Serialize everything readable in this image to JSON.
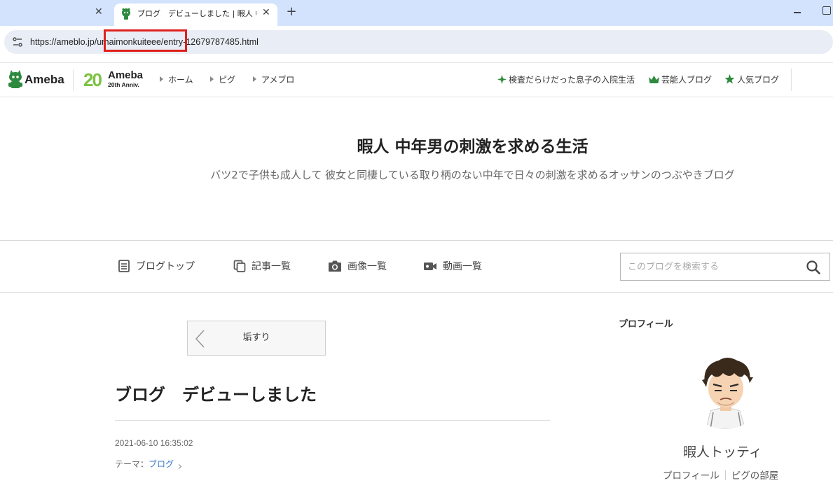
{
  "browser": {
    "active_tab_title": "ブログ　デビューしました | 暇人 中年男の刺激を求める生活",
    "inactive_tab_close": "✕",
    "active_tab_close": "✕",
    "new_tab": "+",
    "url_domain": "https://ameblo.jp/",
    "url_highlight": "umaimonkuiteee",
    "url_path": "/entry-12679787485.html",
    "highlight_color": "#e0201b"
  },
  "ameba_header": {
    "logo_text": "Ameba",
    "anniv_number": "20",
    "anniv_name": "Ameba",
    "anniv_sub": "20th Anniv.",
    "global_nav": [
      "ホーム",
      "ピグ",
      "アメブロ"
    ],
    "hot_topic": "検査だらけだった息子の入院生活",
    "celebrity_blog": "芸能人ブログ",
    "popular_blog": "人気ブログ",
    "accent_color": "#2d8a3e"
  },
  "blog": {
    "title": "暇人 中年男の刺激を求める生活",
    "description": "バツ2で子供も成人して 彼女と同棲している取り柄のない中年で日々の刺激を求めるオッサンのつぶやきブログ"
  },
  "blog_nav": {
    "items": [
      {
        "label": "ブログトップ",
        "icon": "document-icon"
      },
      {
        "label": "記事一覧",
        "icon": "copy-icon"
      },
      {
        "label": "画像一覧",
        "icon": "camera-icon"
      },
      {
        "label": "動画一覧",
        "icon": "video-icon"
      }
    ],
    "search_placeholder": "このブログを検索する"
  },
  "entry": {
    "prev_entry_label": "垢すり",
    "title": "ブログ　デビューしました",
    "date": "2021-06-10 16:35:02",
    "theme_label": "テーマ：",
    "theme_value": "ブログ"
  },
  "sidebar": {
    "profile_heading": "プロフィール",
    "profile_name": "暇人トッティ",
    "profile_link": "プロフィール",
    "pigg_link": "ピグの部屋"
  }
}
